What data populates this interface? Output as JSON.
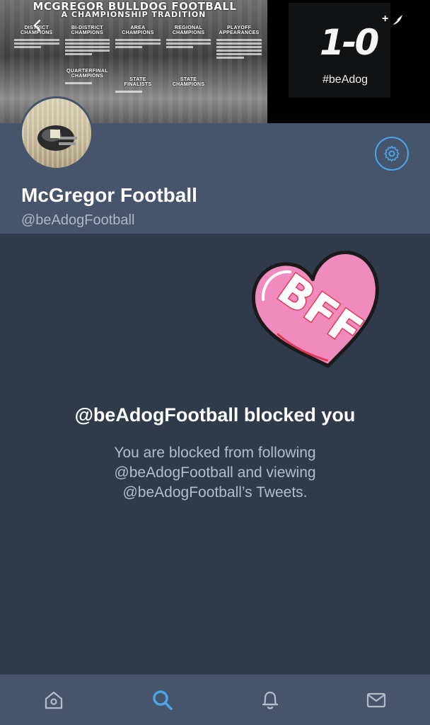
{
  "banner": {
    "title": "MCGREGOR BULLDOG FOOTBALL",
    "subtitle": "A CHAMPIONSHIP TRADITION",
    "columns": [
      {
        "label": "DISTRICT CHAMPIONS"
      },
      {
        "label": "BI-DISTRICT CHAMPIONS"
      },
      {
        "label": "AREA CHAMPIONS"
      },
      {
        "label": "REGIONAL CHAMPIONS"
      },
      {
        "label": "PLAYOFF APPEARANCES"
      }
    ],
    "lower_columns": [
      {
        "label": "QUARTERFINAL CHAMPIONS"
      },
      {
        "label": "STATE FINALISTS"
      },
      {
        "label": "STATE CHAMPIONS"
      }
    ],
    "score_card": {
      "score": "1-0",
      "plus": "+",
      "hashtag": "#beAdog"
    }
  },
  "profile": {
    "display_name": "McGregor Football",
    "handle": "@beAdogFootball"
  },
  "blocked": {
    "heading": "@beAdogFootball blocked you",
    "description": "You are blocked from following @beAdogFootball and viewing @beAdogFootball’s Tweets."
  },
  "sticker": {
    "text": "BFF",
    "colors": {
      "heart": "#f08bbd",
      "outline": "#1a1a1a",
      "letters": "#e43955"
    }
  },
  "nav": {
    "items": [
      {
        "icon": "home-icon"
      },
      {
        "icon": "search-icon",
        "active": true
      },
      {
        "icon": "bell-icon"
      },
      {
        "icon": "mail-icon"
      }
    ]
  },
  "colors": {
    "accent": "#4aa6e8",
    "background": "#2f3a4b",
    "header_bar": "#46556b",
    "muted_text": "#b4bdcb"
  }
}
